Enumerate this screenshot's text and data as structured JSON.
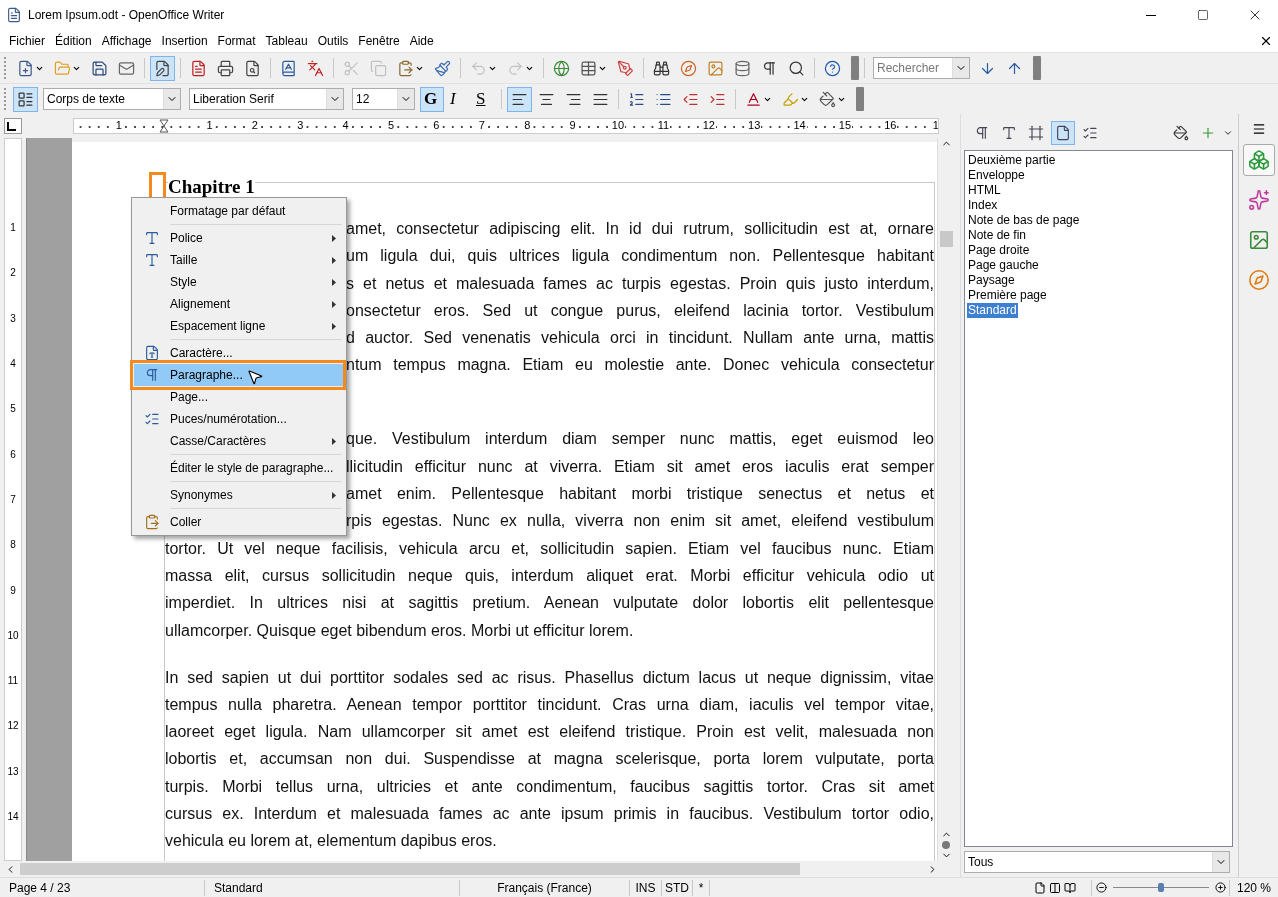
{
  "window": {
    "title": "Lorem Ipsum.odt - OpenOffice Writer"
  },
  "menu_bar": [
    "Fichier",
    "Édition",
    "Affichage",
    "Insertion",
    "Format",
    "Tableau",
    "Outils",
    "Fenêtre",
    "Aide"
  ],
  "standard_toolbar": {
    "items": [
      {
        "kind": "button",
        "menu": true,
        "selected": false,
        "disabled": false
      },
      {
        "kind": "button",
        "menu": true,
        "selected": false,
        "disabled": false
      },
      {
        "kind": "button",
        "menu": false,
        "selected": false,
        "disabled": false
      },
      {
        "kind": "button",
        "menu": false,
        "selected": false,
        "disabled": false
      },
      {
        "kind": "separator"
      },
      {
        "kind": "button",
        "menu": false,
        "selected": true,
        "disabled": false
      },
      {
        "kind": "separator"
      },
      {
        "kind": "button",
        "menu": false,
        "selected": false,
        "disabled": false
      },
      {
        "kind": "button",
        "menu": false,
        "selected": false,
        "disabled": false
      },
      {
        "kind": "button",
        "menu": false,
        "selected": false,
        "disabled": false
      },
      {
        "kind": "separator"
      },
      {
        "kind": "button",
        "menu": false,
        "selected": false,
        "disabled": false
      },
      {
        "kind": "button",
        "menu": false,
        "selected": false,
        "disabled": false
      },
      {
        "kind": "separator"
      },
      {
        "kind": "button",
        "menu": false,
        "selected": false,
        "disabled": true
      },
      {
        "kind": "button",
        "menu": false,
        "selected": false,
        "disabled": true
      },
      {
        "kind": "button",
        "menu": true,
        "selected": false,
        "disabled": false
      },
      {
        "kind": "button",
        "menu": false,
        "selected": false,
        "disabled": false
      },
      {
        "kind": "separator"
      },
      {
        "kind": "button",
        "menu": true,
        "selected": false,
        "disabled": true
      },
      {
        "kind": "button",
        "menu": true,
        "selected": false,
        "disabled": true
      },
      {
        "kind": "separator"
      },
      {
        "kind": "button",
        "menu": false,
        "selected": false,
        "disabled": false
      },
      {
        "kind": "button",
        "menu": true,
        "selected": false,
        "disabled": false
      },
      {
        "kind": "button",
        "menu": false,
        "selected": false,
        "disabled": false
      },
      {
        "kind": "separator"
      },
      {
        "kind": "button",
        "menu": false,
        "selected": false,
        "disabled": false
      },
      {
        "kind": "button",
        "menu": false,
        "selected": false,
        "disabled": false
      },
      {
        "kind": "button",
        "menu": false,
        "selected": false,
        "disabled": false
      },
      {
        "kind": "button",
        "menu": false,
        "selected": false,
        "disabled": false
      },
      {
        "kind": "button",
        "menu": false,
        "selected": false,
        "disabled": false
      },
      {
        "kind": "button",
        "menu": false,
        "selected": false,
        "disabled": false
      },
      {
        "kind": "separator"
      },
      {
        "kind": "button",
        "menu": false,
        "selected": false,
        "disabled": false
      }
    ],
    "search": {
      "placeholder": "Rechercher"
    }
  },
  "formatting_toolbar": {
    "paragraph_style": "Corps de texte",
    "font_name": "Liberation Serif",
    "font_size": "12",
    "items": [
      {
        "kind": "text",
        "label": "G",
        "selected": true
      },
      {
        "kind": "text",
        "label": "I",
        "selected": false
      },
      {
        "kind": "text",
        "label": "S",
        "selected": false
      },
      {
        "kind": "separator"
      },
      {
        "kind": "button",
        "menu": false,
        "selected": true
      },
      {
        "kind": "button",
        "menu": false,
        "selected": false
      },
      {
        "kind": "button",
        "menu": false,
        "selected": false
      },
      {
        "kind": "button",
        "menu": false,
        "selected": false
      },
      {
        "kind": "separator"
      },
      {
        "kind": "button",
        "menu": false,
        "selected": false
      },
      {
        "kind": "button",
        "menu": false,
        "selected": false
      },
      {
        "kind": "button",
        "menu": false,
        "selected": false
      },
      {
        "kind": "button",
        "menu": false,
        "selected": false
      },
      {
        "kind": "separator"
      },
      {
        "kind": "button",
        "menu": true,
        "selected": false
      },
      {
        "kind": "button",
        "menu": true,
        "selected": false
      },
      {
        "kind": "button",
        "menu": true,
        "selected": false
      }
    ]
  },
  "ruler": {
    "labels": [
      "1",
      "1",
      "2",
      "3",
      "4",
      "5",
      "6",
      "7",
      "8",
      "9",
      "10",
      "11",
      "12",
      "13",
      "14",
      "15",
      "16",
      "1"
    ]
  },
  "vertical_ruler": {
    "labels": [
      "1",
      "2",
      "3",
      "4",
      "5",
      "6",
      "7",
      "8",
      "9",
      "10",
      "11",
      "12",
      "13",
      "14"
    ]
  },
  "document": {
    "heading": "Chapitre 1",
    "paragraphs": [
      {
        "lines": [
          {
            "kind": "partial",
            "text": "amet, consectetur adipiscing elit. In id dui rutrum, sollicitudin est at, ornare"
          },
          {
            "kind": "partial",
            "text": "um ligula dui, quis ultrices ligula condimentum non. Pellentesque habitant"
          },
          {
            "kind": "partial",
            "text": "s et netus et malesuada fames ac turpis egestas. Proin quis justo interdum,"
          },
          {
            "kind": "partial",
            "text": "onsectetur eros. Sed ut congue purus, eleifend lacinia tortor. Vestibulum"
          },
          {
            "kind": "partial",
            "text": "d auctor. Sed venenatis vehicula orci in tincidunt. Nullam ante urna, mattis"
          },
          {
            "kind": "partial",
            "text": "ntum tempus magna. Etiam eu molestie ante. Donec vehicula consectetur"
          }
        ]
      },
      {
        "lines": [
          {
            "kind": "partial",
            "text": "que. Vestibulum interdum diam semper nunc mattis, eget euismod leo"
          },
          {
            "kind": "partial",
            "text": "llicitudin efficitur nunc at viverra. Etiam sit amet eros iaculis erat semper"
          },
          {
            "kind": "partial",
            "text": "amet enim. Pellentesque habitant morbi tristique senectus et netus et"
          },
          {
            "kind": "partial",
            "text": "rpis egestas. Nunc ex nulla, viverra non enim sit amet, eleifend vestibulum"
          },
          {
            "kind": "full",
            "text": "tortor. Ut vel neque facilisis, vehicula arcu et, sollicitudin sapien. Etiam vel faucibus nunc. Etiam"
          },
          {
            "kind": "full",
            "text": "massa elit, cursus sollicitudin neque quis, interdum aliquet erat. Morbi efficitur vehicula odio ut"
          },
          {
            "kind": "full",
            "text": "imperdiet. In ultrices nisi at sagittis pretium. Aenean vulputate dolor lobortis elit pellentesque"
          },
          {
            "kind": "last",
            "text": "ullamcorper. Quisque eget bibendum eros. Morbi ut efficitur lorem."
          }
        ]
      },
      {
        "lines": [
          {
            "kind": "full",
            "text": "In sed sapien ut dui porttitor sodales sed ac risus. Phasellus dictum lacus ut neque dignissim, vitae"
          },
          {
            "kind": "full",
            "text": "tempus nulla pharetra. Aenean tempor porttitor tincidunt. Cras urna diam, iaculis vel tempor vitae,"
          },
          {
            "kind": "full",
            "text": "laoreet eget ligula. Nam ullamcorper sit amet est eleifend tristique. Proin est velit, malesuada non"
          },
          {
            "kind": "full",
            "text": "lobortis et, accumsan non dui. Suspendisse at magna scelerisque, porta lorem vulputate, porta"
          },
          {
            "kind": "full",
            "text": "turpis. Morbi tellus urna, ultricies et ante condimentum, faucibus sagittis tortor. Cras sit amet"
          },
          {
            "kind": "full",
            "text": "cursus ex. Interdum et malesuada fames ac ante ipsum primis in faucibus. Vestibulum tortor odio,"
          },
          {
            "kind": "last",
            "text": "vehicula eu lorem at, elementum dapibus eros."
          }
        ]
      }
    ]
  },
  "context_menu": {
    "items": [
      {
        "kind": "item",
        "label": "Formatage par défaut",
        "submenu": false,
        "selected": false
      },
      {
        "kind": "separator"
      },
      {
        "kind": "item",
        "label": "Police",
        "submenu": true,
        "selected": false
      },
      {
        "kind": "item",
        "label": "Taille",
        "submenu": true,
        "selected": false
      },
      {
        "kind": "item",
        "label": "Style",
        "submenu": true,
        "selected": false
      },
      {
        "kind": "item",
        "label": "Alignement",
        "submenu": true,
        "selected": false
      },
      {
        "kind": "item",
        "label": "Espacement ligne",
        "submenu": true,
        "selected": false
      },
      {
        "kind": "separator"
      },
      {
        "kind": "item",
        "label": "Caractère...",
        "submenu": false,
        "selected": false
      },
      {
        "kind": "item",
        "label": "Paragraphe...",
        "submenu": false,
        "selected": true
      },
      {
        "kind": "item",
        "label": "Page...",
        "submenu": false,
        "selected": false
      },
      {
        "kind": "item",
        "label": "Puces/numérotation...",
        "submenu": false,
        "selected": false
      },
      {
        "kind": "item",
        "label": "Casse/Caractères",
        "submenu": true,
        "selected": false
      },
      {
        "kind": "separator"
      },
      {
        "kind": "item",
        "label": "Éditer le style de paragraphe...",
        "submenu": false,
        "selected": false
      },
      {
        "kind": "separator"
      },
      {
        "kind": "item",
        "label": "Synonymes",
        "submenu": true,
        "selected": false
      },
      {
        "kind": "separator"
      },
      {
        "kind": "item",
        "label": "Coller",
        "submenu": false,
        "selected": false
      }
    ]
  },
  "styles_panel": {
    "categories": [
      {
        "selected": false
      },
      {
        "selected": false
      },
      {
        "selected": false
      },
      {
        "selected": true
      },
      {
        "selected": false
      }
    ],
    "styles": [
      {
        "label": "Deuxième partie",
        "selected": false
      },
      {
        "label": "Enveloppe",
        "selected": false
      },
      {
        "label": "HTML",
        "selected": false
      },
      {
        "label": "Index",
        "selected": false
      },
      {
        "label": "Note de bas de page",
        "selected": false
      },
      {
        "label": "Note de fin",
        "selected": false
      },
      {
        "label": "Page droite",
        "selected": false
      },
      {
        "label": "Page gauche",
        "selected": false
      },
      {
        "label": "Paysage",
        "selected": false
      },
      {
        "label": "Première page",
        "selected": false
      },
      {
        "label": "Standard",
        "selected": true
      }
    ],
    "filter": "Tous"
  },
  "sidebar_tabs": [
    {
      "selected": true
    },
    {
      "selected": false
    },
    {
      "selected": false
    },
    {
      "selected": false
    }
  ],
  "status_bar": {
    "page": "Page 4 / 23",
    "page_style": "Standard",
    "language": "Français (France)",
    "insert_mode": "INS",
    "selection_mode": "STD",
    "modified": "*",
    "zoom": {
      "level": 0.5
    },
    "zoom_value": "120 %"
  }
}
